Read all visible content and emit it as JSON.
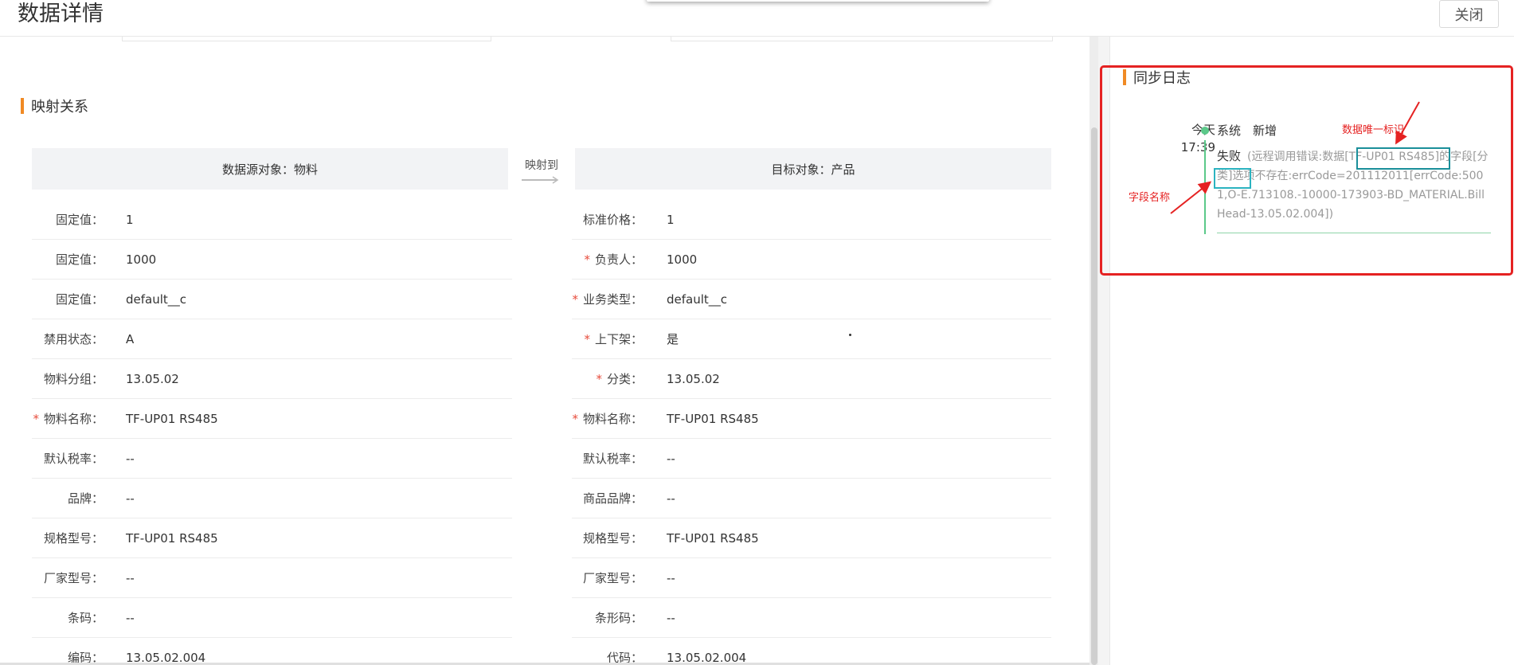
{
  "header": {
    "title": "数据详情",
    "close_label": "关闭"
  },
  "mapping": {
    "section_title": "映射关系",
    "source_header": "数据源对象：物料",
    "arrow_label": "映射到",
    "target_header": "目标对象：产品",
    "source_rows": [
      {
        "label": "固定值：",
        "value": "1",
        "required": false
      },
      {
        "label": "固定值：",
        "value": "1000",
        "required": false
      },
      {
        "label": "固定值：",
        "value": "default__c",
        "required": false
      },
      {
        "label": "禁用状态：",
        "value": "A",
        "required": false
      },
      {
        "label": "物料分组：",
        "value": "13.05.02",
        "required": false
      },
      {
        "label": "物料名称：",
        "value": "TF-UP01 RS485",
        "required": true
      },
      {
        "label": "默认税率：",
        "value": "--",
        "required": false
      },
      {
        "label": "品牌：",
        "value": "--",
        "required": false
      },
      {
        "label": "规格型号：",
        "value": "TF-UP01 RS485",
        "required": false
      },
      {
        "label": "厂家型号：",
        "value": "--",
        "required": false
      },
      {
        "label": "条码：",
        "value": "--",
        "required": false
      },
      {
        "label": "编码：",
        "value": "13.05.02.004",
        "required": false
      }
    ],
    "target_rows": [
      {
        "label": "标准价格：",
        "value": "1",
        "required": false
      },
      {
        "label": "负责人：",
        "value": "1000",
        "required": true
      },
      {
        "label": "业务类型：",
        "value": "default__c",
        "required": true
      },
      {
        "label": "上下架：",
        "value": "是",
        "required": true
      },
      {
        "label": "分类：",
        "value": "13.05.02",
        "required": true
      },
      {
        "label": "物料名称：",
        "value": "TF-UP01 RS485",
        "required": true
      },
      {
        "label": "默认税率：",
        "value": "--",
        "required": false
      },
      {
        "label": "商品品牌：",
        "value": "--",
        "required": false
      },
      {
        "label": "规格型号：",
        "value": "TF-UP01 RS485",
        "required": false
      },
      {
        "label": "厂家型号：",
        "value": "--",
        "required": false
      },
      {
        "label": "条形码：",
        "value": "--",
        "required": false
      },
      {
        "label": "代码：",
        "value": "13.05.02.004",
        "required": false
      }
    ]
  },
  "sync_log": {
    "title": "同步日志",
    "entries": [
      {
        "day": "今天",
        "time": "17:39",
        "user": "系统",
        "action": "新增",
        "status": "失败",
        "message": "(远程调用错误:数据[TF-UP01 RS485]的字段[分类]选项不存在:errCode=201112011[errCode:5001,O-E.713108.-10000-173903-BD_MATERIAL.BillHead-13.05.02.004])"
      }
    ]
  },
  "annotations": {
    "unique_id": "数据唯一标识",
    "field_name": "字段名称"
  },
  "colors": {
    "accent": "#f08a24",
    "success_dot": "#5cc98a",
    "required": "#e74c3c",
    "annotation_red": "#e52222",
    "highlight_box": "#1a8f9a"
  }
}
